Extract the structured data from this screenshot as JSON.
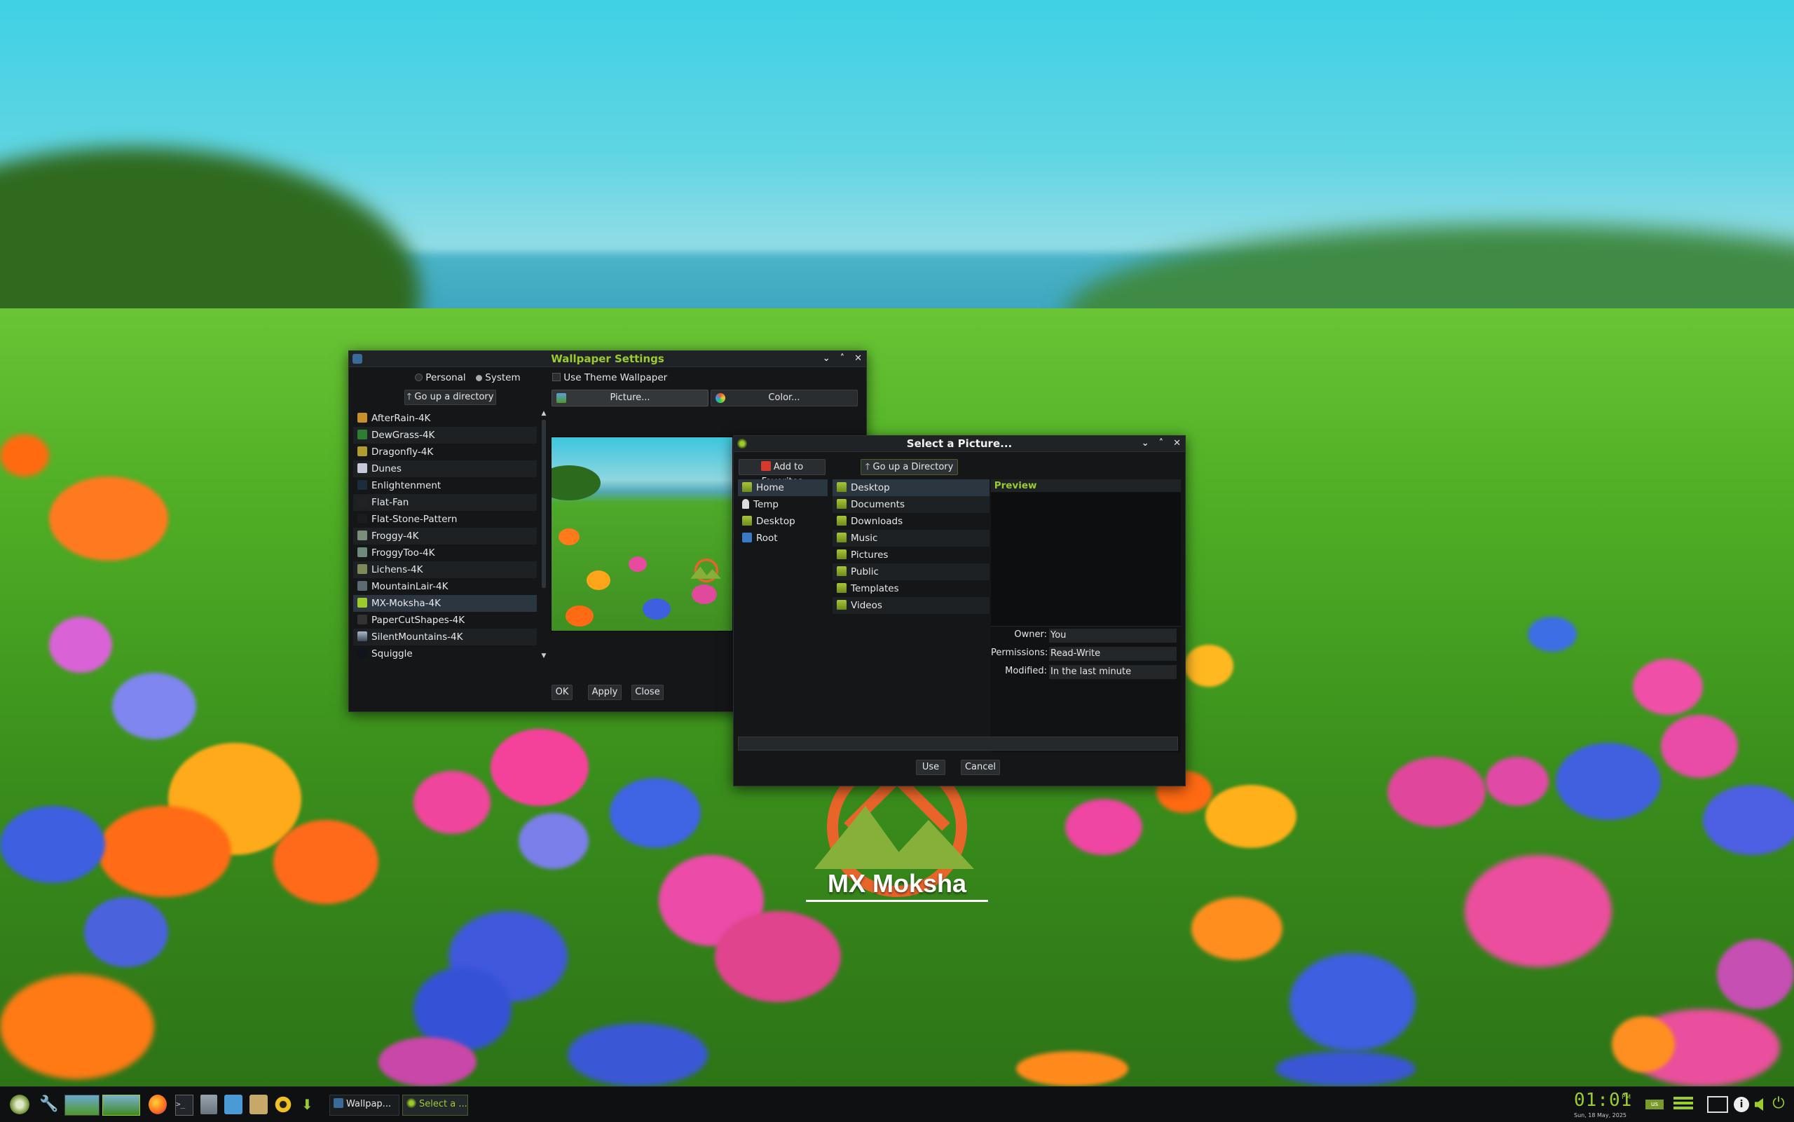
{
  "desktop": {
    "logo_text": "MX Moksha"
  },
  "wallpaper_settings": {
    "title": "Wallpaper Settings",
    "radio_personal": "Personal",
    "radio_system": "System",
    "use_theme_wallpaper": "Use Theme Wallpaper",
    "go_up_label": "Go up a directory",
    "picture_label": "Picture...",
    "color_label": "Color...",
    "items": [
      "AfterRain-4K",
      "DewGrass-4K",
      "Dragonfly-4K",
      "Dunes",
      "Enlightenment",
      "Flat-Fan",
      "Flat-Stone-Pattern",
      "Froggy-4K",
      "FroggyToo-4K",
      "Lichens-4K",
      "MountainLair-4K",
      "MX-Moksha-4K",
      "PaperCutShapes-4K",
      "SilentMountains-4K",
      "Squiggle"
    ],
    "selected_item": "MX-Moksha-4K",
    "ok_label": "OK",
    "apply_label": "Apply",
    "close_label": "Close"
  },
  "select_picture": {
    "title": "Select a Picture...",
    "add_favorites_label": "Add to Favorites",
    "go_up_label": "Go up a Directory",
    "favorites": [
      "Home",
      "Temp",
      "Desktop",
      "Root"
    ],
    "folders": [
      "Desktop",
      "Documents",
      "Downloads",
      "Music",
      "Pictures",
      "Public",
      "Templates",
      "Videos"
    ],
    "preview_label": "Preview",
    "owner_label": "Owner:",
    "owner_value": "You",
    "permissions_label": "Permissions:",
    "permissions_value": "Read-Write",
    "modified_label": "Modified:",
    "modified_value": "In the last minute",
    "path_value": "",
    "use_label": "Use",
    "cancel_label": "Cancel"
  },
  "taskbar": {
    "task_wallpaper": "Wallpap...",
    "task_select": "Select a ...",
    "clock_time": "01:01",
    "clock_ampm": "PM",
    "clock_date": "Sun, 18 May, 2025",
    "kbd_layout": "us"
  },
  "colors": {
    "accent": "#9ccc2c",
    "window_bg": "#141618",
    "selected_row": "#2c3640"
  }
}
